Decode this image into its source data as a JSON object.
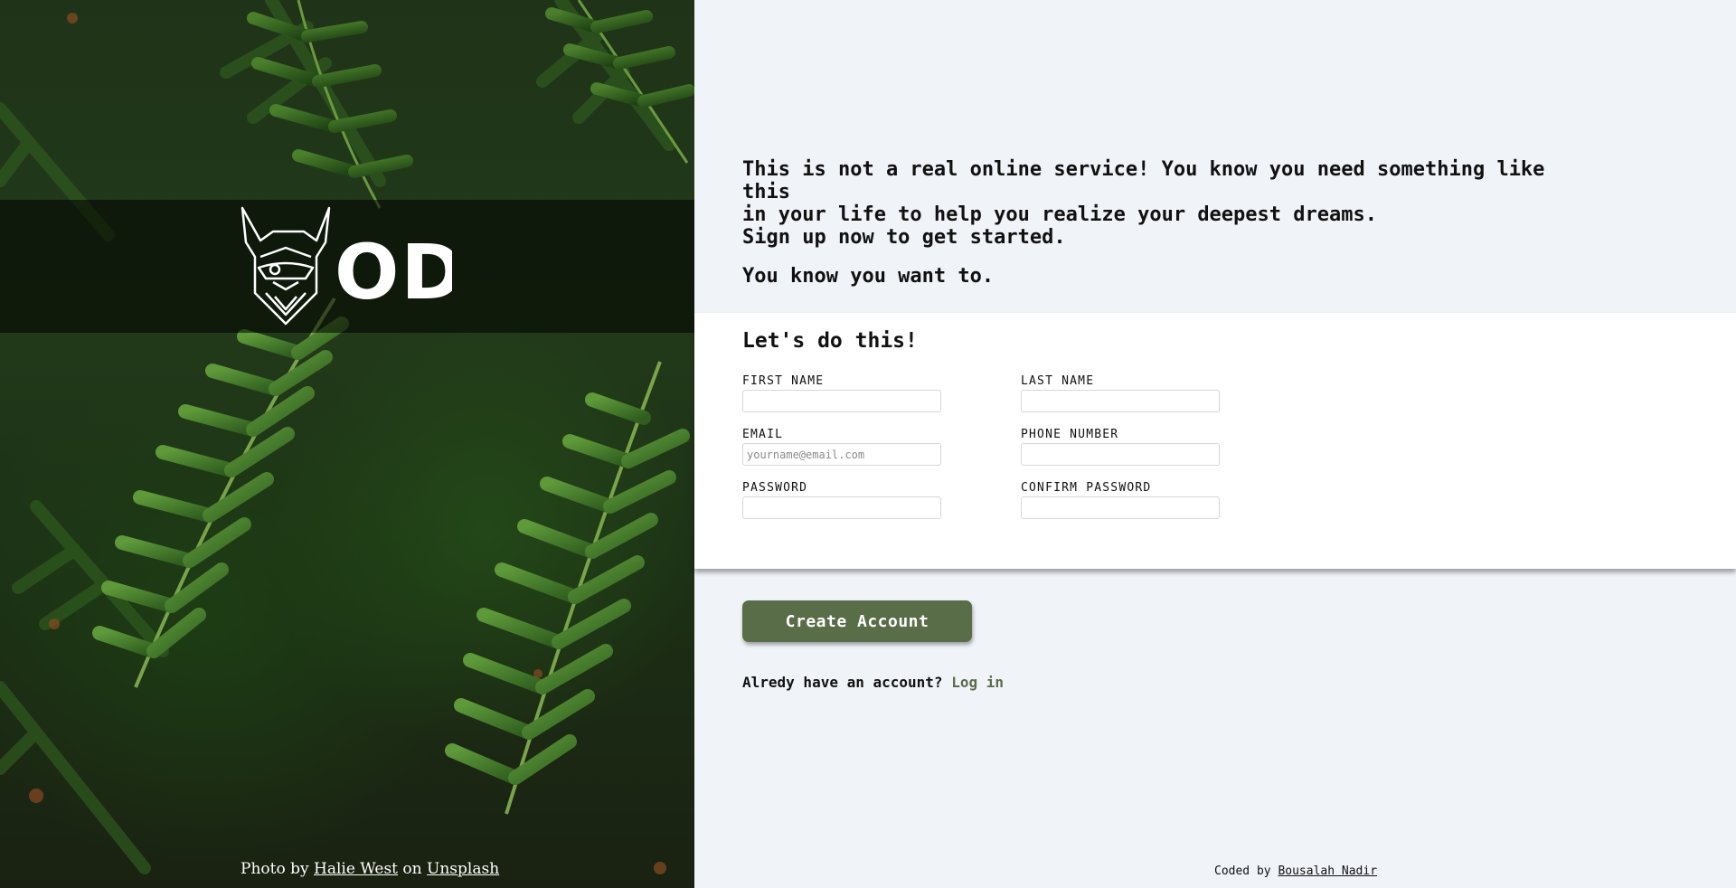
{
  "hero": {
    "brand": "ODIN",
    "credit": {
      "prefix": "Photo by",
      "author": "Halie West",
      "on": "on",
      "site": "Unsplash"
    }
  },
  "intro": {
    "line1": "This is not a real online service! You know you need something like this",
    "line2": "in your life to help you realize your deepest dreams.",
    "line3": "Sign up now to get started.",
    "line4": "You know you want to."
  },
  "form": {
    "heading": "Let's do this!",
    "fields": [
      {
        "label": "FIRST NAME",
        "value": "",
        "placeholder": ""
      },
      {
        "label": "LAST NAME",
        "value": "",
        "placeholder": ""
      },
      {
        "label": "EMAIL",
        "value": "",
        "placeholder": "yourname@email.com"
      },
      {
        "label": "PHONE NUMBER",
        "value": "",
        "placeholder": ""
      },
      {
        "label": "PASSWORD",
        "value": "",
        "placeholder": ""
      },
      {
        "label": "CONFIRM PASSWORD",
        "value": "",
        "placeholder": ""
      }
    ]
  },
  "actions": {
    "create_label": "Create Account",
    "login_prompt": "Alredy have an account?",
    "login_link": "Log in"
  },
  "footer": {
    "coded_by": "Coded by",
    "author": "Bousalah Nadir"
  },
  "colors": {
    "accent": "#596d48",
    "page_bg": "#f0f3f8",
    "panel_bg": "#ffffff"
  }
}
